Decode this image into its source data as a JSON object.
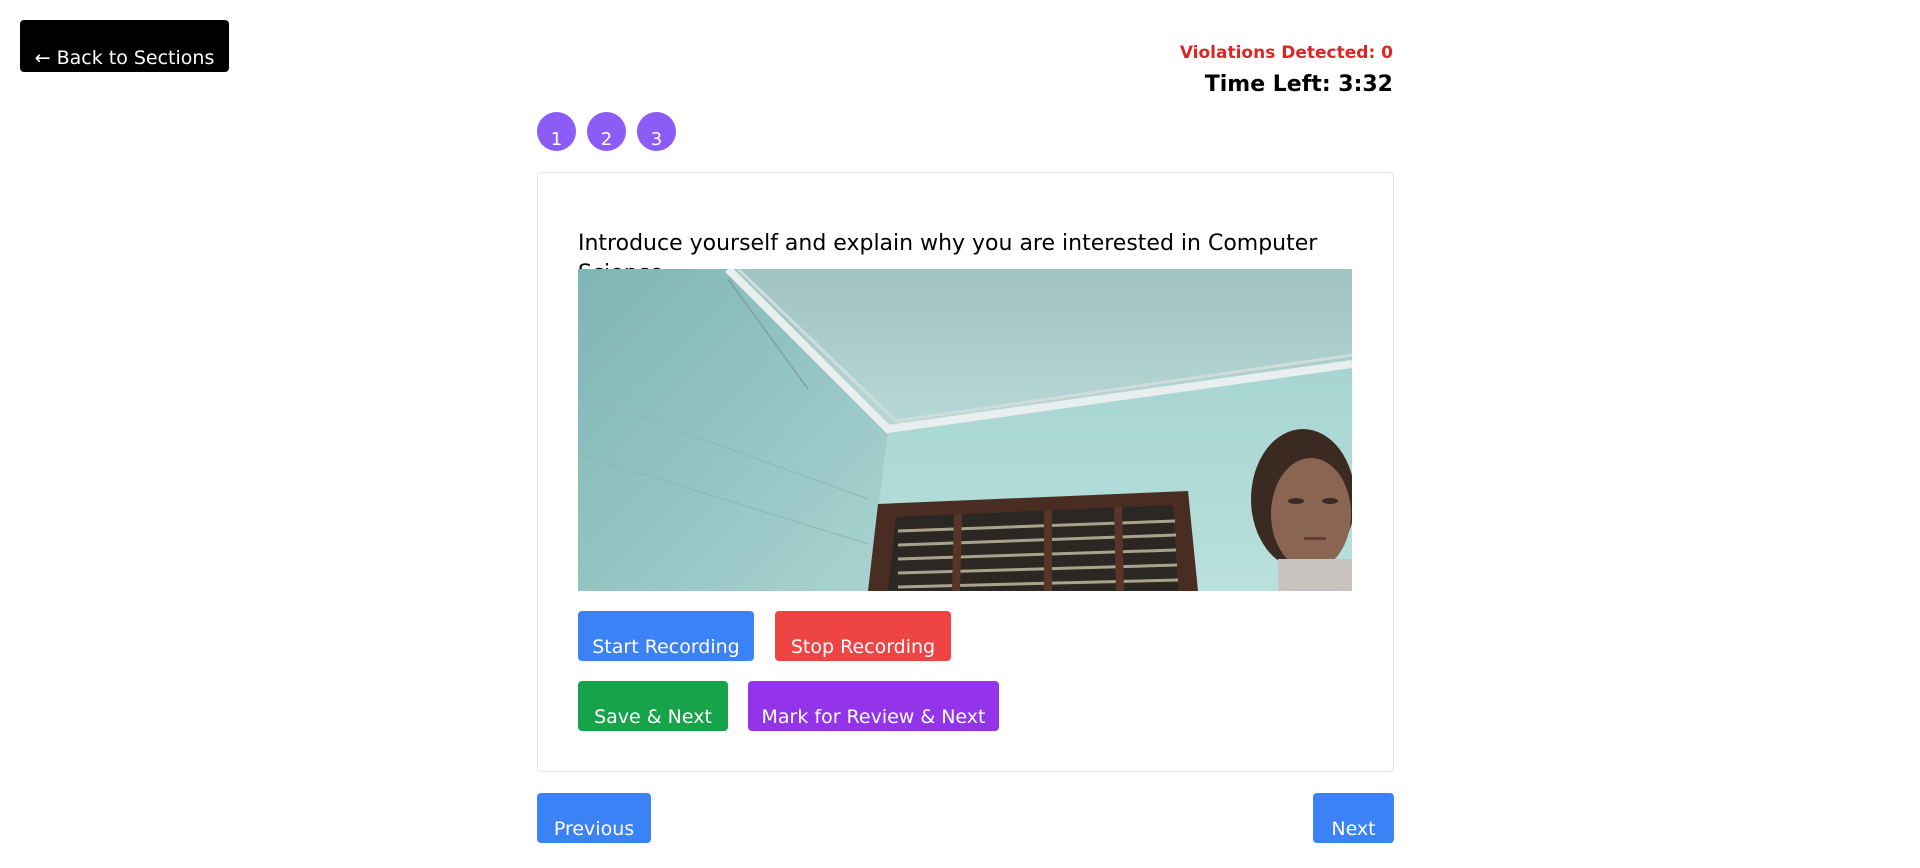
{
  "header": {
    "back_label": "← Back to Sections"
  },
  "status": {
    "violations": "Violations Detected: 0",
    "time_left": "Time Left: 3:32",
    "violations_color": "#dc2626"
  },
  "question_nav": {
    "items": [
      "1",
      "2",
      "3"
    ],
    "color": "#8b5cf6"
  },
  "question": {
    "text": "Introduce yourself and explain why you are interested in Computer Science."
  },
  "video": {
    "icon": "webcam-feed"
  },
  "actions": {
    "start_recording": "Start Recording",
    "stop_recording": "Stop Recording",
    "save_next": "Save & Next",
    "mark_review_next": "Mark for Review & Next"
  },
  "footer": {
    "previous": "Previous",
    "next": "Next"
  },
  "colors": {
    "primary": "#3b82f6",
    "danger": "#ef4444",
    "success": "#16a34a",
    "purple": "#9333ea"
  }
}
